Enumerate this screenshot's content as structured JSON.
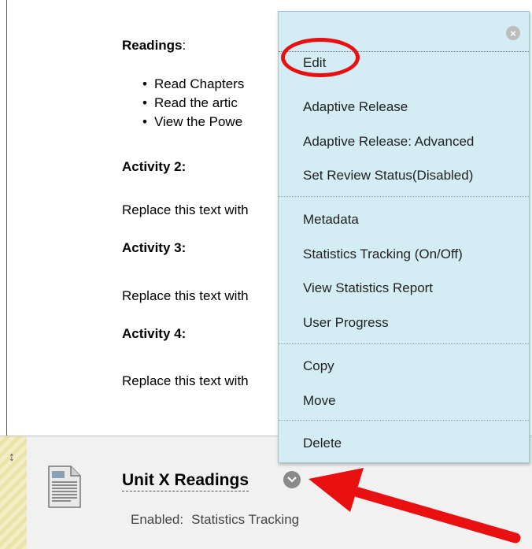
{
  "content": {
    "readings_label": "Readings",
    "readings_colon": ":",
    "bullets": [
      "Read Chapters",
      "Read the artic",
      "View the Powe"
    ],
    "activities": [
      {
        "title": "Activity 2:",
        "text": "Replace this text with"
      },
      {
        "title": "Activity 3:",
        "text": "Replace this text with"
      },
      {
        "title": "Activity 4:",
        "text": "Replace this text with"
      }
    ]
  },
  "item": {
    "title": "Unit X Readings",
    "meta_label": "Enabled:",
    "meta_value": "Statistics Tracking"
  },
  "menu": {
    "items": [
      "Edit",
      "Adaptive Release",
      "Adaptive Release: Advanced",
      "Set Review Status(Disabled)",
      "Metadata",
      "Statistics Tracking (On/Off)",
      "View Statistics Report",
      "User Progress",
      "Copy",
      "Move",
      "Delete"
    ]
  },
  "icons": {
    "close": "close-icon",
    "drag": "drag-handle-icon",
    "document": "document-icon",
    "chevron": "chevron-down-icon"
  },
  "colors": {
    "menu_bg": "#d4ecf4",
    "annotation_red": "#e81010",
    "row_bg": "#f1f1f1"
  }
}
